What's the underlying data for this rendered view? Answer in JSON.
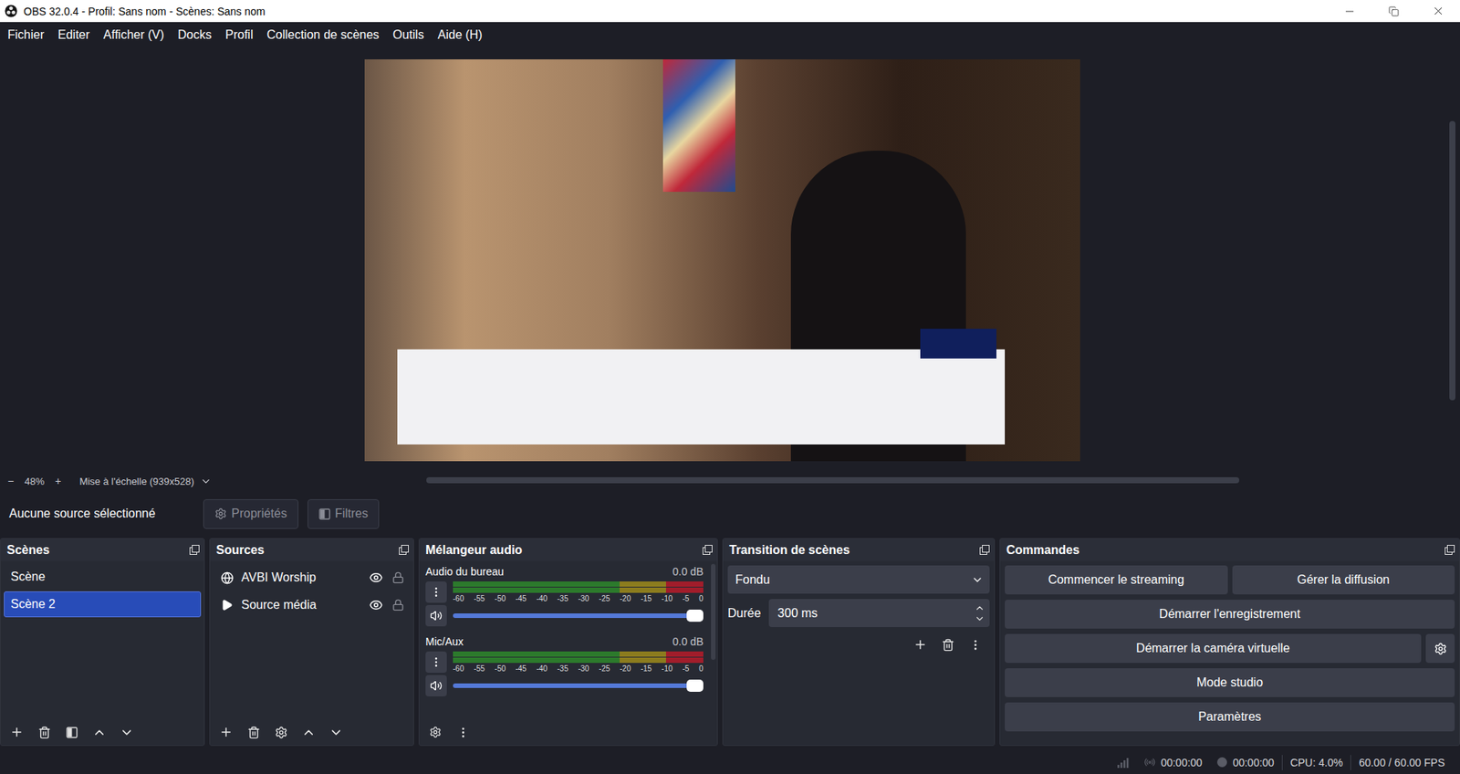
{
  "window": {
    "title": "OBS 32.0.4 - Profil: Sans nom - Scènes: Sans nom"
  },
  "menu": [
    "Fichier",
    "Editer",
    "Afficher (V)",
    "Docks",
    "Profil",
    "Collection de scènes",
    "Outils",
    "Aide (H)"
  ],
  "preview": {
    "zoom_out": "−",
    "zoom": "48%",
    "zoom_in": "+",
    "scale": "Mise à l'échelle (939x528)"
  },
  "context": {
    "label": "Aucune source sélectionné",
    "buttons": [
      {
        "label": "Propriétés",
        "kind": "properties",
        "disabled": true
      },
      {
        "label": "Filtres",
        "kind": "filters",
        "disabled": true
      }
    ]
  },
  "scenes": {
    "title": "Scènes",
    "items": [
      {
        "name": "Scène",
        "selected": false
      },
      {
        "name": "Scène 2",
        "selected": true
      }
    ]
  },
  "sources": {
    "title": "Sources",
    "items": [
      {
        "name": "AVBI Worship",
        "kind": "browser",
        "visible": true,
        "locked": false
      },
      {
        "name": "Source média",
        "kind": "media",
        "visible": true,
        "locked": false
      }
    ]
  },
  "mixer": {
    "title": "Mélangeur audio",
    "ticks": [
      "-60",
      "-55",
      "-50",
      "-45",
      "-40",
      "-35",
      "-30",
      "-25",
      "-20",
      "-15",
      "-10",
      "-5",
      "0"
    ],
    "channels": [
      {
        "name": "Audio du bureau",
        "reading": "0.0 dB",
        "muted": false,
        "meter": {
          "level": 0
        },
        "volume": {
          "level": 1
        }
      },
      {
        "name": "Mic/Aux",
        "reading": "0.0 dB",
        "muted": false,
        "meter": {
          "level": 0
        },
        "volume": {
          "level": 1
        }
      }
    ]
  },
  "transition": {
    "title": "Transition de scènes",
    "type": "Fondu",
    "duration_label": "Durée",
    "duration": "300 ms"
  },
  "commands": {
    "title": "Commandes",
    "rows": [
      {
        "kind": "pair",
        "buttons": [
          "Commencer le streaming",
          "Gérer la diffusion"
        ]
      },
      {
        "kind": "single",
        "buttons": [
          "Démarrer l'enregistrement"
        ]
      },
      {
        "kind": "with-settings",
        "buttons": [
          "Démarrer la caméra virtuelle"
        ]
      },
      {
        "kind": "single",
        "buttons": [
          "Mode studio"
        ]
      },
      {
        "kind": "single",
        "buttons": [
          "Paramètres"
        ]
      }
    ]
  },
  "status": {
    "stream_time": "00:00:00",
    "record_time": "00:00:00",
    "cpu": "CPU: 4.0%",
    "fps": "60.00 / 60.00 FPS"
  }
}
